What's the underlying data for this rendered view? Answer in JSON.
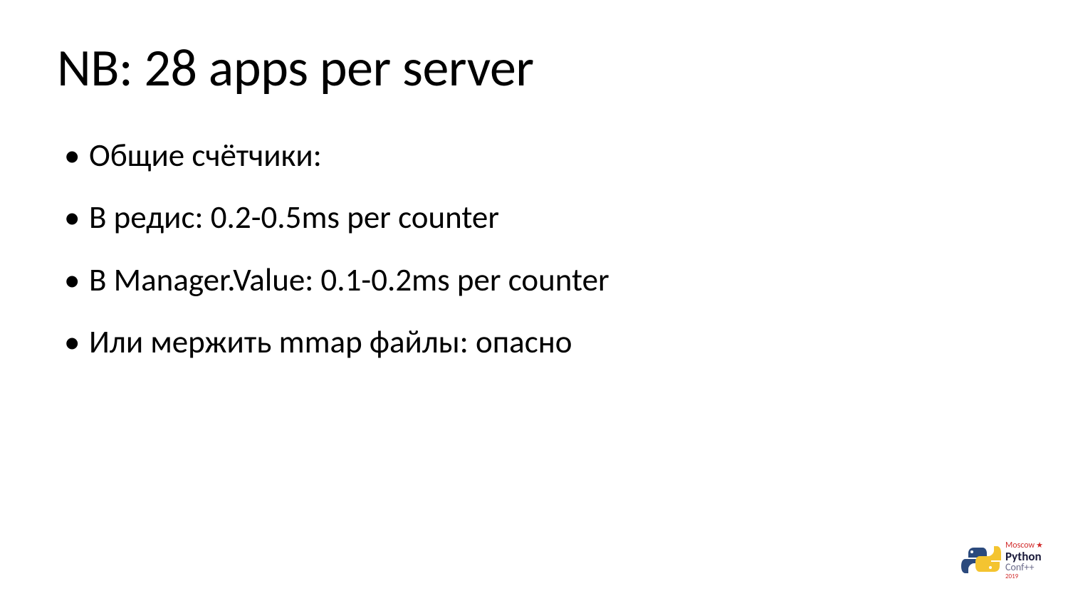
{
  "slide": {
    "title": "NB: 28 apps per server",
    "bullets": [
      "Общие счётчики:",
      "В редис: 0.2-0.5ms per counter",
      "В Manager.Value: 0.1-0.2ms per counter",
      "Или мержить mmap файлы: опасно"
    ]
  },
  "logo": {
    "moscow": "Moscow",
    "python": "Python",
    "conf": "Conf++",
    "year": "2019"
  }
}
